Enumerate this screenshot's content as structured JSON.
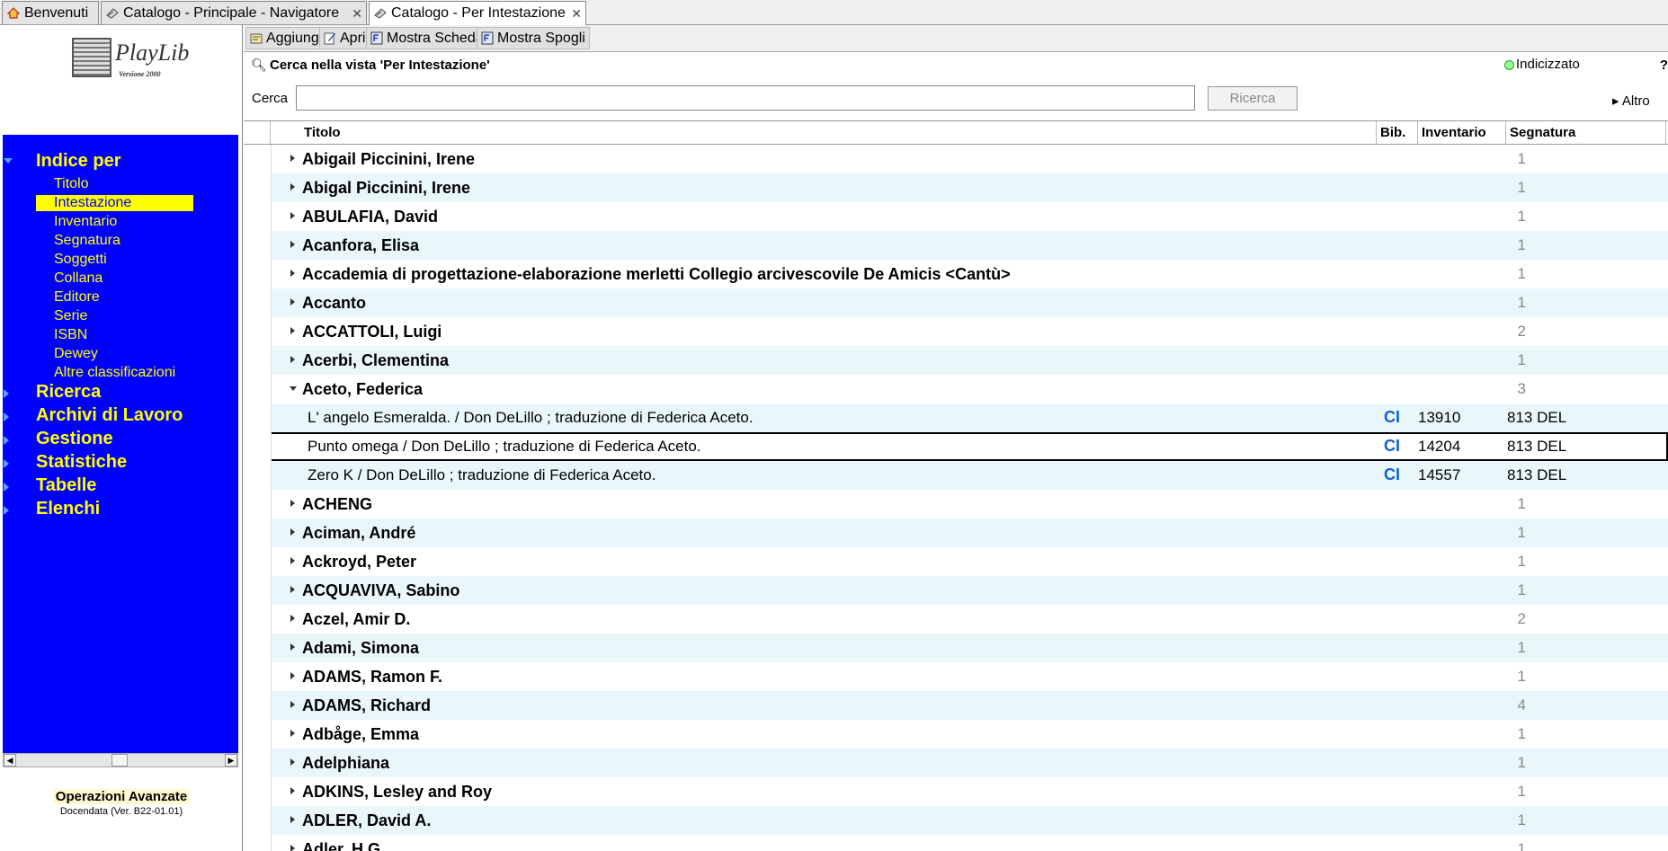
{
  "tabs": [
    {
      "label": "Benvenuti",
      "icon": "home-icon",
      "closable": false,
      "active": false
    },
    {
      "label": "Catalogo - Principale - Navigatore",
      "icon": "catalog-icon",
      "closable": true,
      "active": false
    },
    {
      "label": "Catalogo - Per Intestazione",
      "icon": "catalog-icon",
      "closable": true,
      "active": true
    }
  ],
  "logo": {
    "text": "PlayLib",
    "subtitle": "Versione 2000"
  },
  "nav": {
    "section_title": "Indice per",
    "index_items": [
      "Titolo",
      "Intestazione",
      "Inventario",
      "Segnatura",
      "Soggetti",
      "Collana",
      "Editore",
      "Serie",
      "ISBN",
      "Dewey",
      "Altre classificazioni"
    ],
    "selected_index": "Intestazione",
    "sections": [
      "Ricerca",
      "Archivi di Lavoro",
      "Gestione",
      "Statistiche",
      "Tabelle",
      "Elenchi"
    ]
  },
  "footer": {
    "title": "Operazioni Avanzate",
    "version": "Docendata (Ver. B22-01.01)"
  },
  "toolbar": {
    "add": "Aggiungi",
    "open": "Apri",
    "show_record": "Mostra Scheda",
    "show_extracts": "Mostra Spogli"
  },
  "search": {
    "title": "Cerca nella vista 'Per Intestazione'",
    "status": "Indicizzato",
    "help": "?",
    "label": "Cerca",
    "value": "",
    "button": "Ricerca",
    "more": "Altro"
  },
  "columns": {
    "titolo": "Titolo",
    "bib": "Bib.",
    "inventario": "Inventario",
    "segnatura": "Segnatura"
  },
  "colors": {
    "nav_bg": "#0000ff",
    "nav_text": "#ffff00",
    "row_alt": "#eaf7fa",
    "bib": "#1060d0"
  },
  "rows": [
    {
      "type": "group",
      "name": "Abigail Piccinini, Irene",
      "count": "1",
      "expanded": false
    },
    {
      "type": "group",
      "name": "Abigal Piccinini, Irene",
      "count": "1",
      "expanded": false
    },
    {
      "type": "group",
      "name": "ABULAFIA, David",
      "count": "1",
      "expanded": false
    },
    {
      "type": "group",
      "name": "Acanfora, Elisa",
      "count": "1",
      "expanded": false
    },
    {
      "type": "group",
      "name": "Accademia di progettazione-elaborazione merletti Collegio arcivescovile De Amicis <Cantù>",
      "count": "1",
      "expanded": false
    },
    {
      "type": "group",
      "name": "Accanto",
      "count": "1",
      "expanded": false
    },
    {
      "type": "group",
      "name": "ACCATTOLI, Luigi",
      "count": "2",
      "expanded": false
    },
    {
      "type": "group",
      "name": "Acerbi, Clementina",
      "count": "1",
      "expanded": false
    },
    {
      "type": "group",
      "name": "Aceto, Federica",
      "count": "3",
      "expanded": true
    },
    {
      "type": "child",
      "title": "L' angelo Esmeralda. / Don DeLillo ; traduzione di Federica Aceto.",
      "bib": "CI",
      "inventario": "13910",
      "segnatura": "813 DEL"
    },
    {
      "type": "child",
      "title": "Punto omega / Don DeLillo ; traduzione di Federica Aceto.",
      "bib": "CI",
      "inventario": "14204",
      "segnatura": "813 DEL",
      "selected": true
    },
    {
      "type": "child",
      "title": "Zero K / Don DeLillo ; traduzione di Federica Aceto.",
      "bib": "CI",
      "inventario": "14557",
      "segnatura": "813 DEL"
    },
    {
      "type": "group",
      "name": "ACHENG",
      "count": "1",
      "expanded": false
    },
    {
      "type": "group",
      "name": "Aciman, André",
      "count": "1",
      "expanded": false
    },
    {
      "type": "group",
      "name": "Ackroyd, Peter",
      "count": "1",
      "expanded": false
    },
    {
      "type": "group",
      "name": "ACQUAVIVA, Sabino",
      "count": "1",
      "expanded": false
    },
    {
      "type": "group",
      "name": "Aczel, Amir D.",
      "count": "2",
      "expanded": false
    },
    {
      "type": "group",
      "name": "Adami, Simona",
      "count": "1",
      "expanded": false
    },
    {
      "type": "group",
      "name": "ADAMS, Ramon F.",
      "count": "1",
      "expanded": false
    },
    {
      "type": "group",
      "name": "ADAMS, Richard",
      "count": "4",
      "expanded": false
    },
    {
      "type": "group",
      "name": "Adbåge, Emma",
      "count": "1",
      "expanded": false
    },
    {
      "type": "group",
      "name": "Adelphiana",
      "count": "1",
      "expanded": false
    },
    {
      "type": "group",
      "name": "ADKINS, Lesley and Roy",
      "count": "1",
      "expanded": false
    },
    {
      "type": "group",
      "name": "ADLER, David A.",
      "count": "1",
      "expanded": false
    },
    {
      "type": "group",
      "name": "Adler, H.G.",
      "count": "1",
      "expanded": false
    }
  ]
}
